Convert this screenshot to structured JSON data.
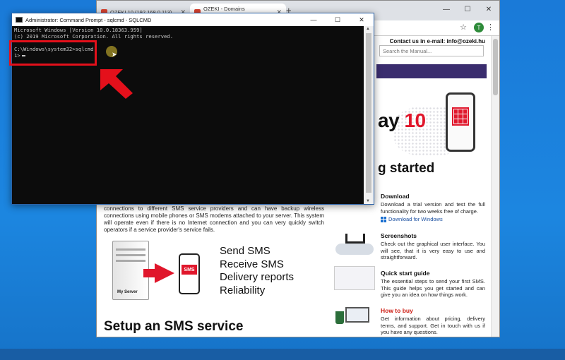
{
  "browser": {
    "tabs": [
      {
        "title": "OZEKI 10 (192.168.0.113)"
      },
      {
        "title": "OZEKI - Domains sms.ozeki.hu"
      }
    ],
    "new_tab": "+",
    "window_controls": {
      "minimize": "—",
      "maximize": "☐",
      "close": "✕"
    },
    "profile_initial": "T"
  },
  "page": {
    "contact": "Contact us in e-mail: info@ozeki.hu",
    "search_placeholder": "Search the Manual...",
    "hero_title_prefix": "ay",
    "hero_title_number": "10",
    "hero_subtitle": "g started",
    "intro_text": "connections to different SMS service providers and can have backup wireless connections using mobile phones or SMS modems attached to your server. This system will operate even if there is no Internet connection and you can very quickly switch operators if a service provider's service fails.",
    "server_label": "My Server",
    "sms_badge": "SMS",
    "features": [
      "Send SMS",
      "Receive SMS",
      "Delivery reports",
      "Reliability"
    ],
    "setup_heading": "Setup an SMS service",
    "sidebar": {
      "download": {
        "title": "Download",
        "text": "Download a trial version and test the full functionality for two weeks free of charge.",
        "link": "Download for Windows"
      },
      "screenshots": {
        "title": "Screenshots",
        "text": "Check out the graphical user interface. You will see, that it is very easy to use and straightforward."
      },
      "quickstart": {
        "title": "Quick start guide",
        "text": "The essential steps to send your first SMS. This guide helps you get started and can give you an idea on how things work."
      },
      "howtobuy": {
        "title": "How to buy",
        "text": "Get information about pricing, delivery terms, and support. Get in touch with us if you have any questions."
      }
    }
  },
  "cmd": {
    "title": "Administrator: Command Prompt - sqlcmd - SQLCMD",
    "controls": {
      "minimize": "—",
      "maximize": "☐",
      "close": "✕"
    },
    "lines": [
      "Microsoft Windows [Version 10.0.18363.959]",
      "(c) 2019 Microsoft Corporation. All rights reserved.",
      "",
      "C:\\Windows\\system32>sqlcmd",
      "1>"
    ]
  },
  "colors": {
    "highlight": "#e4101b",
    "brand_red": "#e0162b",
    "desktop": "#1c86e0"
  }
}
